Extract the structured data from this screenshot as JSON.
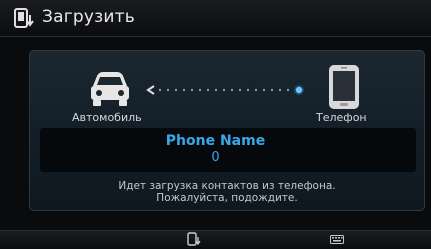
{
  "header": {
    "title": "Загрузить",
    "icon": "phone-download-icon"
  },
  "transfer": {
    "source_label": "Автомобиль",
    "target_label": "Телефон",
    "source_icon": "car-icon",
    "target_icon": "smartphone-icon",
    "arrow_icon": "dotted-arrow-icon"
  },
  "phone_info": {
    "name": "Phone Name",
    "count": "0"
  },
  "message": {
    "line1": "Идет загрузка контактов из телефона.",
    "line2": "Пожалуйста, подождите."
  },
  "footer": {
    "left_icon": "phone-download-icon",
    "right_icon": "keyboard-icon"
  },
  "colors": {
    "accent": "#3aa8e8",
    "text": "#e8e8e8",
    "background": "#0a0b0d"
  }
}
